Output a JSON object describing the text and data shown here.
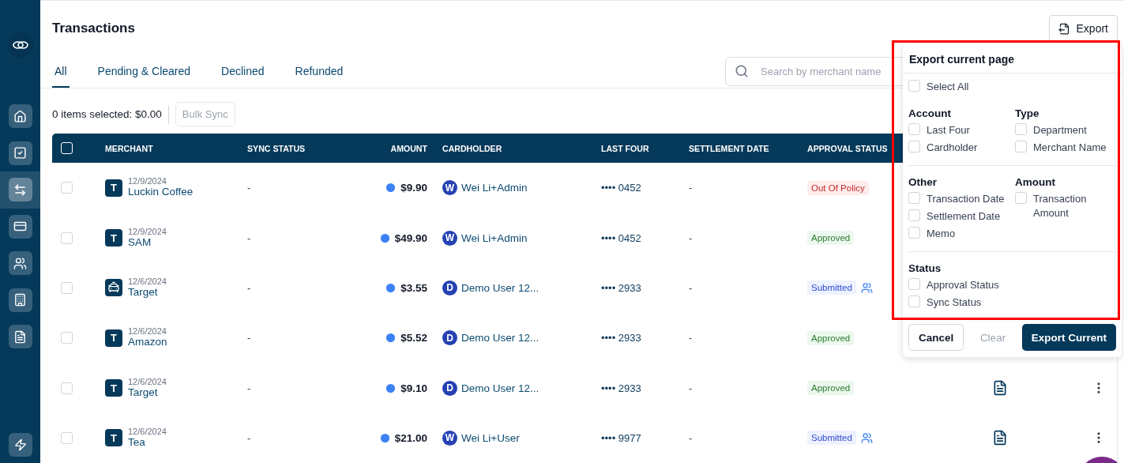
{
  "sidebar": {
    "items": [
      {
        "selected": false
      },
      {
        "selected": false
      },
      {
        "selected": true
      },
      {
        "selected": false
      },
      {
        "selected": false
      },
      {
        "selected": false
      },
      {
        "selected": false
      }
    ]
  },
  "header": {
    "title": "Transactions",
    "export_label": "Export"
  },
  "tabs": [
    {
      "label": "All",
      "selected": true
    },
    {
      "label": "Pending & Cleared",
      "selected": false
    },
    {
      "label": "Declined",
      "selected": false
    },
    {
      "label": "Refunded",
      "selected": false
    }
  ],
  "search": {
    "placeholder": "Search by merchant name"
  },
  "selection": {
    "summary": "0 items selected: $0.00",
    "bulk_label": "Bulk Sync",
    "bulk_disabled": true
  },
  "table": {
    "select_all_checked": false,
    "columns": [
      "MERCHANT",
      "SYNC STATUS",
      "AMOUNT",
      "CARDHOLDER",
      "LAST FOUR",
      "SETTLEMENT DATE",
      "APPROVAL STATUS"
    ],
    "rows": [
      {
        "checked": false,
        "avatar": {
          "kind": "letter",
          "text": "T"
        },
        "date": "12/9/2024",
        "merchant": "Luckin Coffee",
        "sync": "-",
        "amount": "$9.90",
        "holder_initial": "W",
        "holder": "Wei Li+Admin",
        "last_four": "•••• 0452",
        "settlement": "-",
        "status": {
          "kind": "out_of_policy",
          "label": "Out Of Policy"
        }
      },
      {
        "checked": false,
        "avatar": {
          "kind": "letter",
          "text": "T"
        },
        "date": "12/9/2024",
        "merchant": "SAM",
        "sync": "-",
        "amount": "$49.90",
        "holder_initial": "W",
        "holder": "Wei Li+Admin",
        "last_four": "•••• 0452",
        "settlement": "-",
        "status": {
          "kind": "approved",
          "label": "Approved"
        }
      },
      {
        "checked": false,
        "avatar": {
          "kind": "car"
        },
        "date": "12/6/2024",
        "merchant": "Target",
        "sync": "-",
        "amount": "$3.55",
        "holder_initial": "D",
        "holder": "Demo User 12...",
        "last_four": "•••• 2933",
        "settlement": "-",
        "status": {
          "kind": "submitted",
          "label": "Submitted"
        }
      },
      {
        "checked": false,
        "avatar": {
          "kind": "letter",
          "text": "T"
        },
        "date": "12/6/2024",
        "merchant": "Amazon",
        "sync": "-",
        "amount": "$5.52",
        "holder_initial": "D",
        "holder": "Demo User 12...",
        "last_four": "•••• 2933",
        "settlement": "-",
        "status": {
          "kind": "approved",
          "label": "Approved"
        }
      },
      {
        "checked": false,
        "avatar": {
          "kind": "letter",
          "text": "T"
        },
        "date": "12/6/2024",
        "merchant": "Target",
        "sync": "-",
        "amount": "$9.10",
        "holder_initial": "D",
        "holder": "Demo User 12...",
        "last_four": "•••• 2933",
        "settlement": "-",
        "status": {
          "kind": "approved",
          "label": "Approved"
        }
      },
      {
        "checked": false,
        "avatar": {
          "kind": "letter",
          "text": "T"
        },
        "date": "12/6/2024",
        "merchant": "Tea",
        "sync": "-",
        "amount": "$21.00",
        "holder_initial": "W",
        "holder": "Wei Li+User",
        "last_four": "•••• 9977",
        "settlement": "-",
        "status": {
          "kind": "submitted",
          "label": "Submitted"
        }
      }
    ]
  },
  "export_popover": {
    "title": "Export current page",
    "select_all": {
      "label": "Select All",
      "checked": false
    },
    "sections": [
      {
        "groups": [
          {
            "title": "Account",
            "items": [
              {
                "label": "Last Four",
                "checked": false
              },
              {
                "label": "Cardholder",
                "checked": false
              }
            ]
          },
          {
            "title": "Type",
            "items": [
              {
                "label": "Department",
                "checked": false
              },
              {
                "label": "Merchant Name",
                "checked": false
              }
            ]
          }
        ]
      },
      {
        "groups": [
          {
            "title": "Other",
            "items": [
              {
                "label": "Transaction Date",
                "checked": false
              },
              {
                "label": "Settlement Date",
                "checked": false
              },
              {
                "label": "Memo",
                "checked": false
              }
            ]
          },
          {
            "title": "Amount",
            "items": [
              {
                "label": "Transaction Amount",
                "checked": false
              }
            ]
          }
        ]
      },
      {
        "groups": [
          {
            "title": "Status",
            "items": [
              {
                "label": "Approval Status",
                "checked": false
              },
              {
                "label": "Sync Status",
                "checked": false
              }
            ]
          }
        ]
      }
    ],
    "buttons": [
      {
        "label": "Cancel",
        "kind": "outline"
      },
      {
        "label": "Clear",
        "kind": "text"
      },
      {
        "label": "Export Current",
        "kind": "primary"
      }
    ]
  }
}
